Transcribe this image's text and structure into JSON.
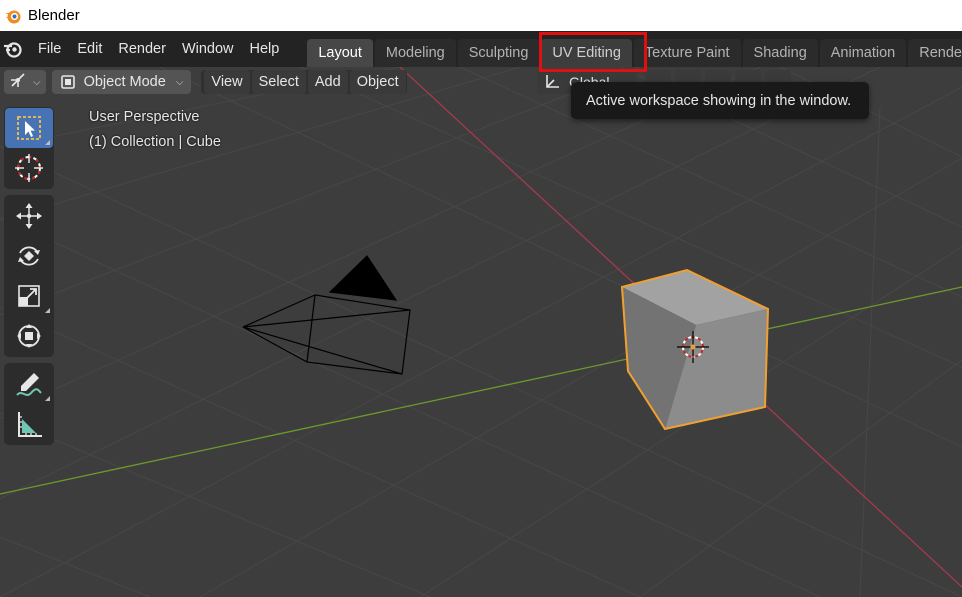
{
  "window": {
    "title": "Blender",
    "icon": "blender-logo-icon"
  },
  "menubar": {
    "items": [
      "File",
      "Edit",
      "Render",
      "Window",
      "Help"
    ]
  },
  "workspaces": {
    "tabs": [
      "Layout",
      "Modeling",
      "Sculpting",
      "UV Editing",
      "Texture Paint",
      "Shading",
      "Animation",
      "Rende"
    ],
    "active": "Layout",
    "hovered": "UV Editing"
  },
  "viewport_header": {
    "mode": "Object Mode",
    "menus": [
      "View",
      "Select",
      "Add",
      "Object"
    ],
    "orientation": "Global"
  },
  "viewport": {
    "perspective_label": "User Perspective",
    "collection_label": "(1) Collection | Cube",
    "background_color": "#3d3d3d",
    "x_axis_color": "#a53a4c",
    "y_axis_color": "#6b9a2d",
    "selection_outline_color": "#f0a030"
  },
  "toolbar": {
    "tools": [
      {
        "name": "select-box-tool",
        "icon": "select-box-icon",
        "active": true
      },
      {
        "name": "cursor-tool",
        "icon": "cursor-icon",
        "active": false
      },
      {
        "name": "move-tool",
        "icon": "move-icon",
        "active": false
      },
      {
        "name": "rotate-tool",
        "icon": "rotate-icon",
        "active": false
      },
      {
        "name": "scale-tool",
        "icon": "scale-icon",
        "active": false
      },
      {
        "name": "transform-tool",
        "icon": "transform-icon",
        "active": false
      },
      {
        "name": "annotate-tool",
        "icon": "annotate-icon",
        "active": false
      },
      {
        "name": "measure-tool",
        "icon": "measure-icon",
        "active": false
      }
    ]
  },
  "tooltip": {
    "text": "Active workspace showing in the window."
  },
  "highlight": {
    "color": "#e01010",
    "target": "UV Editing"
  }
}
